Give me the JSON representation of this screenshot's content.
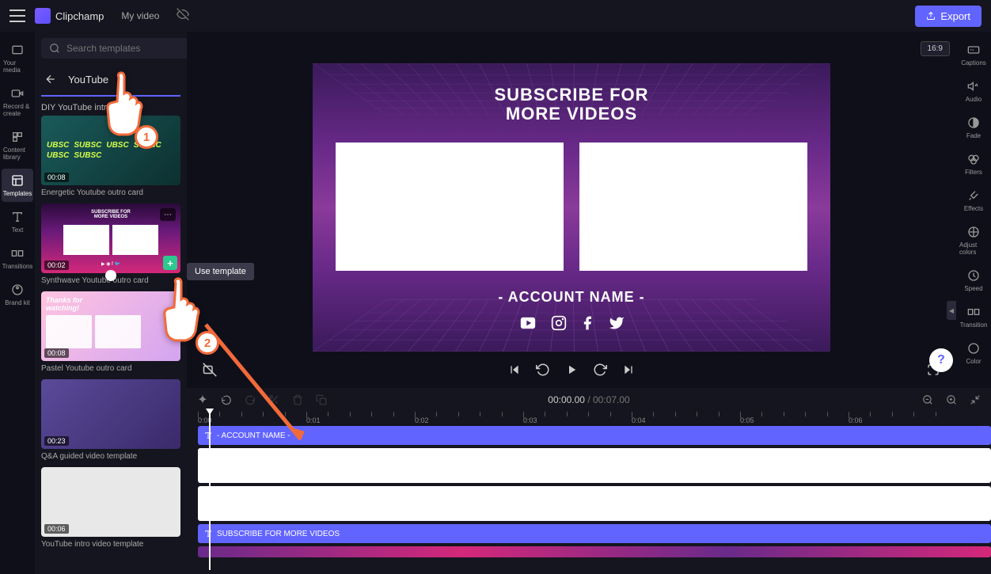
{
  "header": {
    "app_name": "Clipchamp",
    "project_title": "My video",
    "export_label": "Export"
  },
  "left_rail": {
    "items": [
      {
        "label": "Your media",
        "icon": "media"
      },
      {
        "label": "Record & create",
        "icon": "record"
      },
      {
        "label": "Content library",
        "icon": "library"
      },
      {
        "label": "Templates",
        "icon": "templates"
      },
      {
        "label": "Text",
        "icon": "text"
      },
      {
        "label": "Transitions",
        "icon": "transitions"
      },
      {
        "label": "Brand kit",
        "icon": "brand"
      }
    ]
  },
  "sidebar": {
    "search_placeholder": "Search templates",
    "category": "YouTube",
    "section_title": "DIY YouTube intro",
    "templates": [
      {
        "name": "Energetic Youtube outro card",
        "duration": "00:08"
      },
      {
        "name": "Synthwave Youtube outro card",
        "duration": "00:02"
      },
      {
        "name": "Pastel Youtube outro card",
        "duration": "00:08"
      },
      {
        "name": "Q&A guided video template",
        "duration": "00:23"
      },
      {
        "name": "YouTube intro video template",
        "duration": "00:06"
      }
    ]
  },
  "tooltip": {
    "use_template": "Use template"
  },
  "right_rail": {
    "items": [
      {
        "label": "Captions",
        "icon": "captions"
      },
      {
        "label": "Audio",
        "icon": "audio"
      },
      {
        "label": "Fade",
        "icon": "fade"
      },
      {
        "label": "Filters",
        "icon": "filters"
      },
      {
        "label": "Effects",
        "icon": "effects"
      },
      {
        "label": "Adjust colors",
        "icon": "adjust"
      },
      {
        "label": "Speed",
        "icon": "speed"
      },
      {
        "label": "Transition",
        "icon": "transition"
      },
      {
        "label": "Color",
        "icon": "color"
      }
    ]
  },
  "preview": {
    "aspect_ratio": "16:9",
    "title_line1": "SUBSCRIBE FOR",
    "title_line2": "MORE VIDEOS",
    "account_name": "- ACCOUNT NAME -"
  },
  "timeline": {
    "current_time": "00:00.00",
    "total_time": "00:07.00",
    "ruler_labels": [
      "0:00",
      "0:01",
      "0:02",
      "0:03",
      "0:04",
      "0:05",
      "0:06"
    ],
    "tracks": [
      {
        "type": "text",
        "label": "- ACCOUNT NAME -"
      },
      {
        "type": "video"
      },
      {
        "type": "video"
      },
      {
        "type": "text",
        "label": "SUBSCRIBE FOR MORE VIDEOS"
      },
      {
        "type": "bg"
      }
    ]
  },
  "annotations": {
    "step1": "1",
    "step2": "2"
  },
  "help": "?"
}
